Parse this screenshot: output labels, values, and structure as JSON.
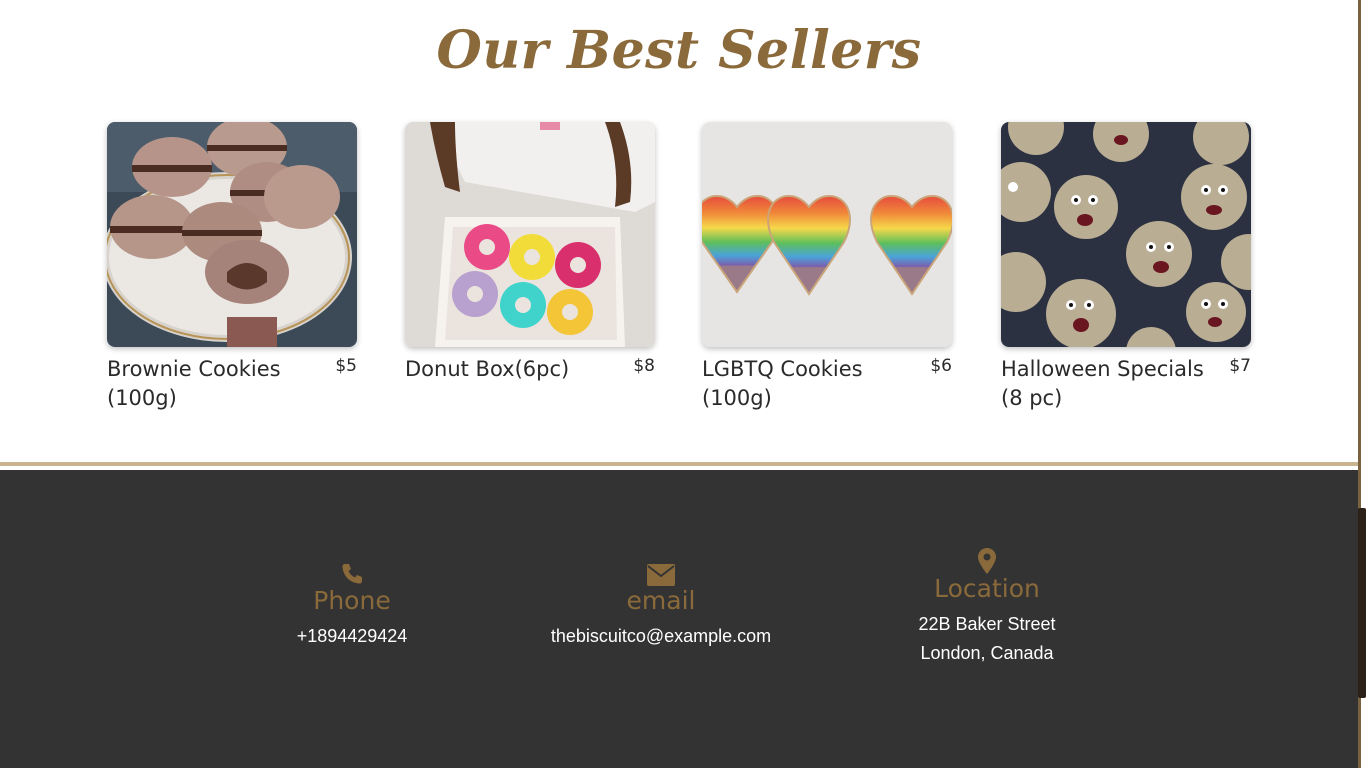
{
  "section": {
    "title": "Our Best Sellers"
  },
  "products": [
    {
      "name": "Brownie Cookies (100g)",
      "price": "$5",
      "image": "macarons-photo"
    },
    {
      "name": "Donut Box(6pc)",
      "price": "$8",
      "image": "donut-box-photo"
    },
    {
      "name": "LGBTQ Cookies (100g)",
      "price": "$6",
      "image": "rainbow-heart-cookies-photo"
    },
    {
      "name": "Halloween Specials (8 pc)",
      "price": "$7",
      "image": "zombie-cookies-photo"
    }
  ],
  "footer": {
    "phone": {
      "icon": "phone-icon",
      "title": "Phone",
      "value": "+1894429424"
    },
    "email": {
      "icon": "envelope-icon",
      "title": "email",
      "value": "thebiscuitco@example.com"
    },
    "location": {
      "icon": "map-pin-icon",
      "title": "Location",
      "line1": "22B Baker Street",
      "line2": "London, Canada"
    }
  },
  "colors": {
    "accent": "#8a6a3a",
    "footer_bg": "#333333",
    "divider": "#c9b391"
  }
}
